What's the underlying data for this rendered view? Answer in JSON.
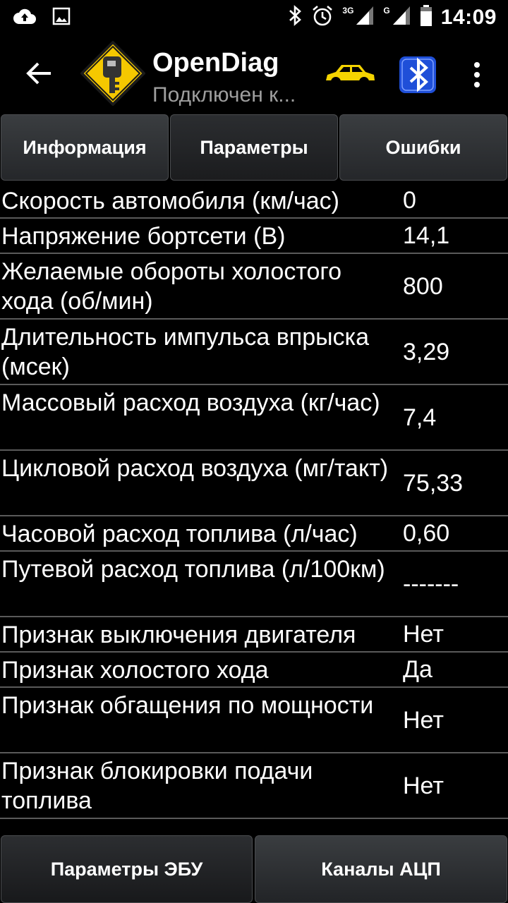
{
  "status_bar": {
    "time": "14:09",
    "net1": "3G",
    "net2": "G"
  },
  "app_bar": {
    "title": "OpenDiag",
    "subtitle": "Подключен к..."
  },
  "tabs": [
    {
      "label": "Информация",
      "active": false
    },
    {
      "label": "Параметры",
      "active": true
    },
    {
      "label": "Ошибки",
      "active": false
    }
  ],
  "params": [
    {
      "name": "Скорость автомобиля (км/час)",
      "value": "0"
    },
    {
      "name": "Напряжение бортсети (В)",
      "value": "14,1"
    },
    {
      "name": "Желаемые обороты холостого хода (об/мин)",
      "value": "800"
    },
    {
      "name": "Длительность импульса впрыска (мсек)",
      "value": "3,29"
    },
    {
      "name": "Массовый расход воздуха (кг/час)",
      "value": "7,4"
    },
    {
      "name": "Цикловой расход воздуха (мг/такт)",
      "value": "75,33"
    },
    {
      "name": "Часовой расход топлива (л/час)",
      "value": "0,60"
    },
    {
      "name": "Путевой расход топлива (л/100км)",
      "value": "-------"
    },
    {
      "name": "Признак выключения двигателя",
      "value": "Нет"
    },
    {
      "name": "Признак холостого хода",
      "value": "Да"
    },
    {
      "name": "Признак обгащения по мощности",
      "value": "Нет"
    },
    {
      "name": "Признак блокировки подачи топлива",
      "value": "Нет"
    }
  ],
  "bottom_tabs": [
    {
      "label": "Параметры ЭБУ",
      "active": true
    },
    {
      "label": "Каналы АЦП",
      "active": false
    }
  ],
  "colors": {
    "background": "#000000",
    "logo_yellow": "#f5c800",
    "car_yellow": "#f5d400",
    "bt_blue": "#1f4fd8",
    "divider": "#5a5a5a"
  }
}
